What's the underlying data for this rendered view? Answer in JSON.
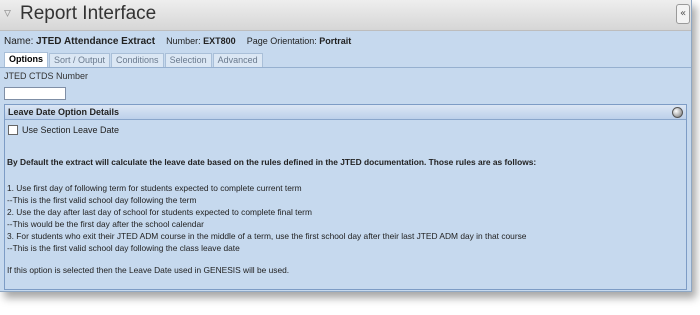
{
  "window": {
    "title": "Report Interface",
    "collapse_glyph": "«",
    "title_icon": "funnel-icon"
  },
  "report": {
    "name_label": "Name:",
    "name_value": "JTED Attendance Extract",
    "number_label": "Number:",
    "number_value": "EXT800",
    "orientation_label": "Page Orientation:",
    "orientation_value": "Portrait"
  },
  "tabs": [
    {
      "label": "Options",
      "active": true
    },
    {
      "label": "Sort / Output",
      "active": false
    },
    {
      "label": "Conditions",
      "active": false
    },
    {
      "label": "Selection",
      "active": false
    },
    {
      "label": "Advanced",
      "active": false
    }
  ],
  "ctds": {
    "label": "JTED CTDS Number",
    "value": ""
  },
  "leave_panel": {
    "header": "Leave Date Option Details",
    "checkbox_label": "Use Section Leave Date",
    "checkbox_checked": false,
    "default_text": "By Default the extract will calculate the leave date based on the rules defined in the JTED documentation. Those rules are as follows:",
    "rules": [
      "1. Use first day of following term for students expected to complete current term",
      "--This is the first valid school day following the term",
      "2. Use the day after last day of school for students expected to complete final term",
      "--This would be the first day after the school calendar",
      "3. For students who exit their JTED ADM course in the middle of a term, use the first school day after their last JTED ADM day in that course",
      "--This is the first valid school day following the class leave date"
    ],
    "footer_text": "If this option is selected then the Leave Date used in GENESIS will be used."
  }
}
